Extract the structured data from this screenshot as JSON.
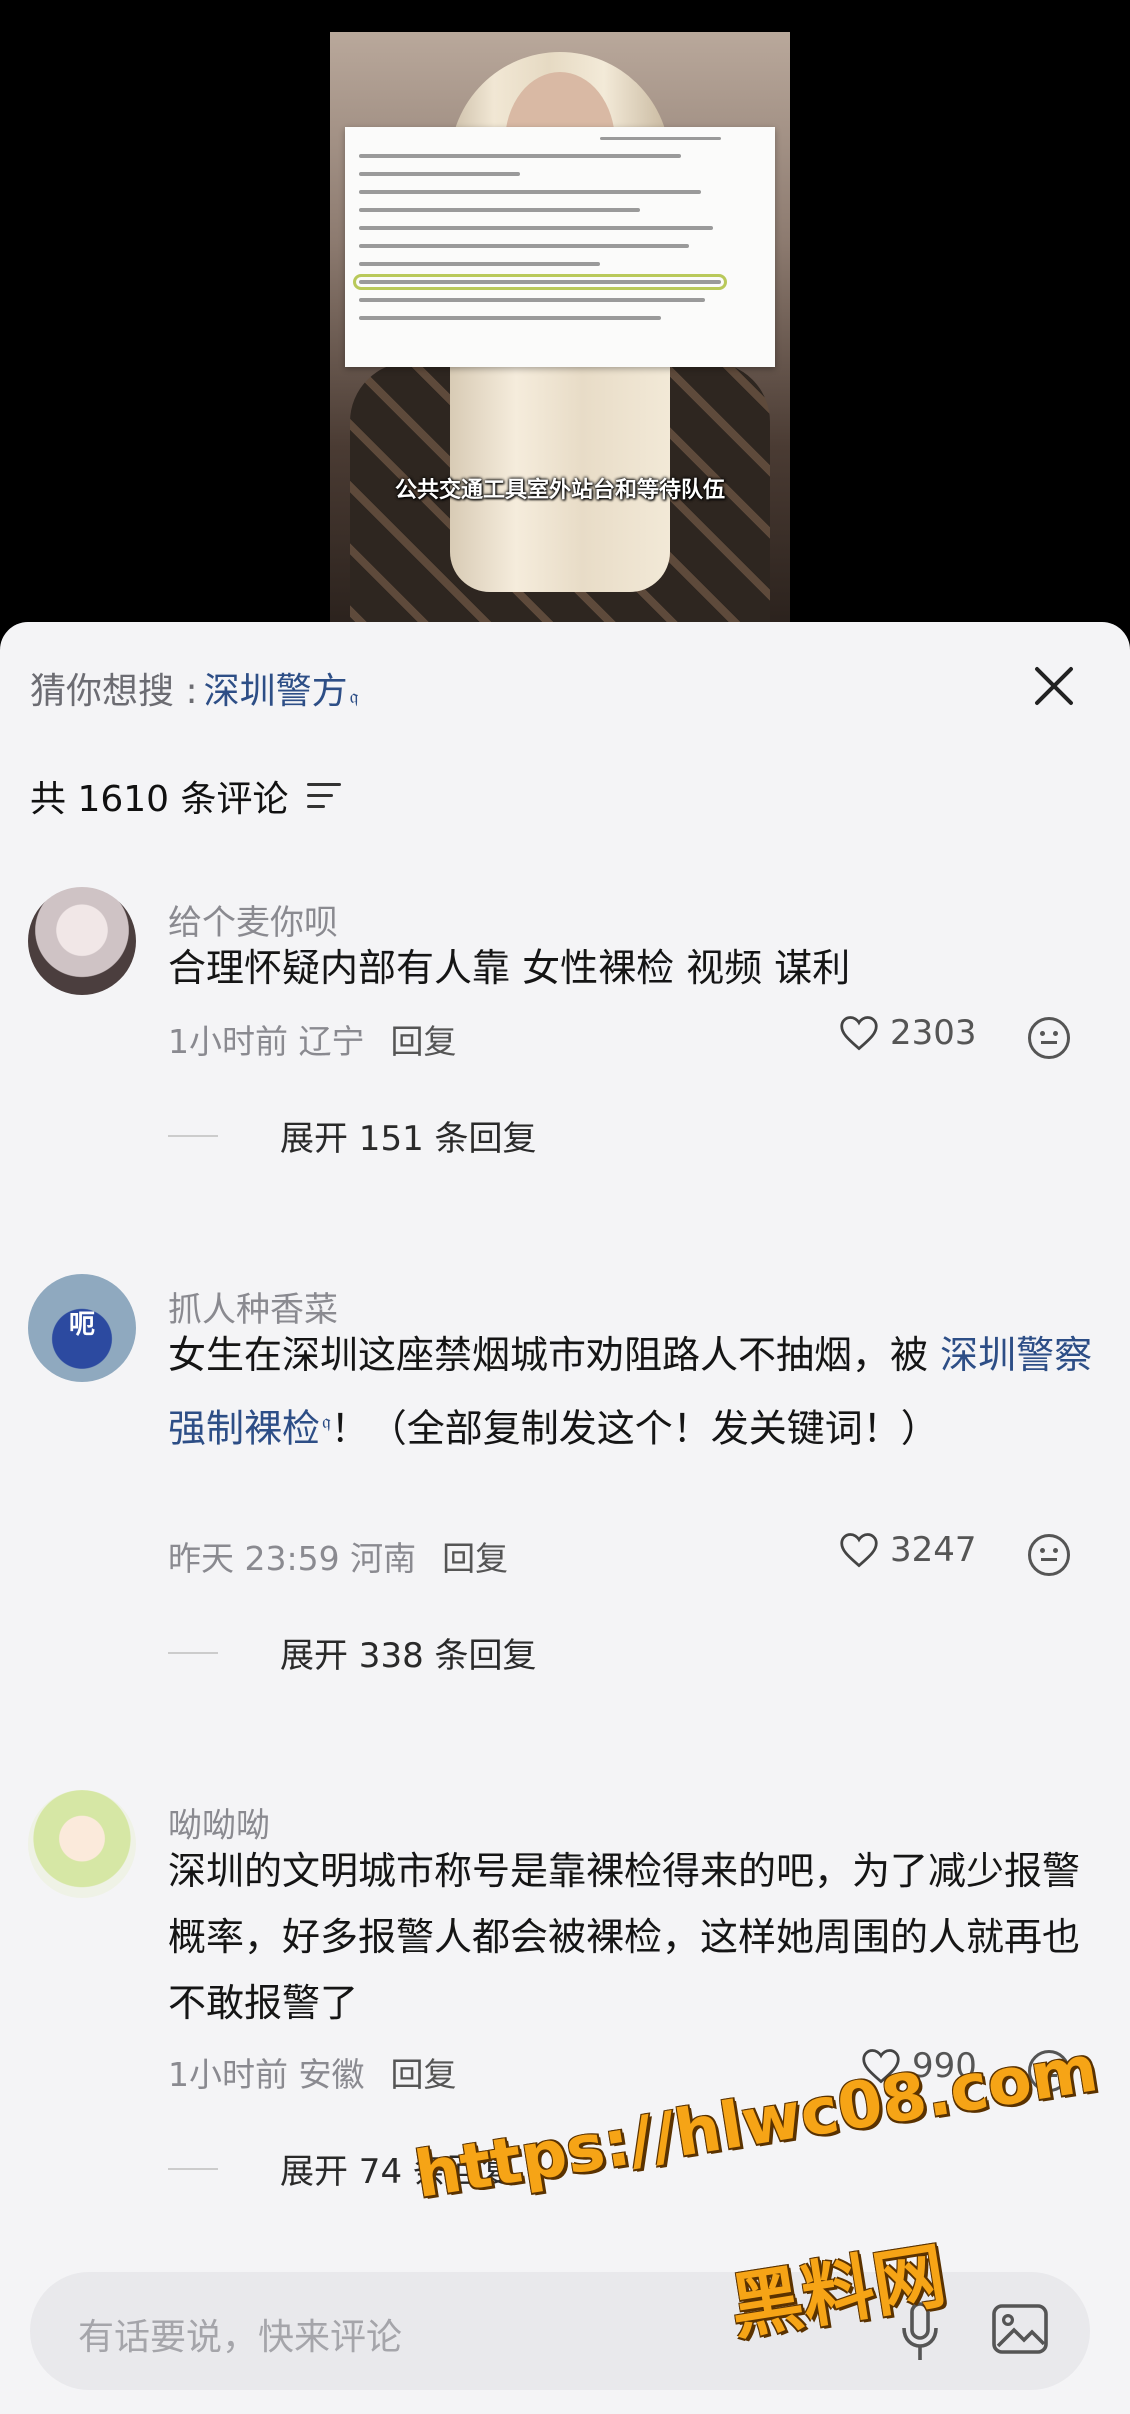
{
  "video": {
    "caption": "公共交通工具室外站台和等待队伍"
  },
  "sheet": {
    "suggest_label": "猜你想搜 :",
    "suggest_term": "深圳警方",
    "comment_count_text": "共 1610 条评论"
  },
  "comments": [
    {
      "user": "给个麦你呗",
      "text": "合理怀疑内部有人靠  女性裸检  视频  谋利",
      "time_location": "1小时前 辽宁",
      "reply_label": "回复",
      "likes": "2303",
      "expand_label": "展开 151 条回复"
    },
    {
      "user": "抓人种香菜",
      "avatar_text": "呃",
      "text_before": "女生在深圳这座禁烟城市劝阻路人不抽烟，被 ",
      "text_link": "深圳警察强制裸检",
      "text_after": "！（全部复制发这个！发关键词！）",
      "time_location": "昨天 23:59 河南",
      "reply_label": "回复",
      "likes": "3247",
      "expand_label": "展开 338 条回复"
    },
    {
      "user": "呦呦呦",
      "text": "深圳的文明城市称号是靠裸检得来的吧，为了减少报警概率，好多报警人都会被裸检，这样她周围的人就再也不敢报警了",
      "time_location": "1小时前 安徽",
      "reply_label": "回复",
      "likes": "990",
      "expand_label": "展开 74 条回复"
    }
  ],
  "input": {
    "placeholder": "有话要说，快来评论"
  },
  "watermark": {
    "url": "https://hlwc08.com",
    "site": "黑料网"
  },
  "colors": {
    "link": "#2d4e86",
    "watermark": "#f6a416",
    "sheet_bg": "#f4f4f6"
  },
  "icons": [
    "search-sup-icon",
    "close-icon",
    "filter-icon",
    "heart-icon",
    "emoji-icon",
    "mic-icon",
    "image-icon"
  ]
}
